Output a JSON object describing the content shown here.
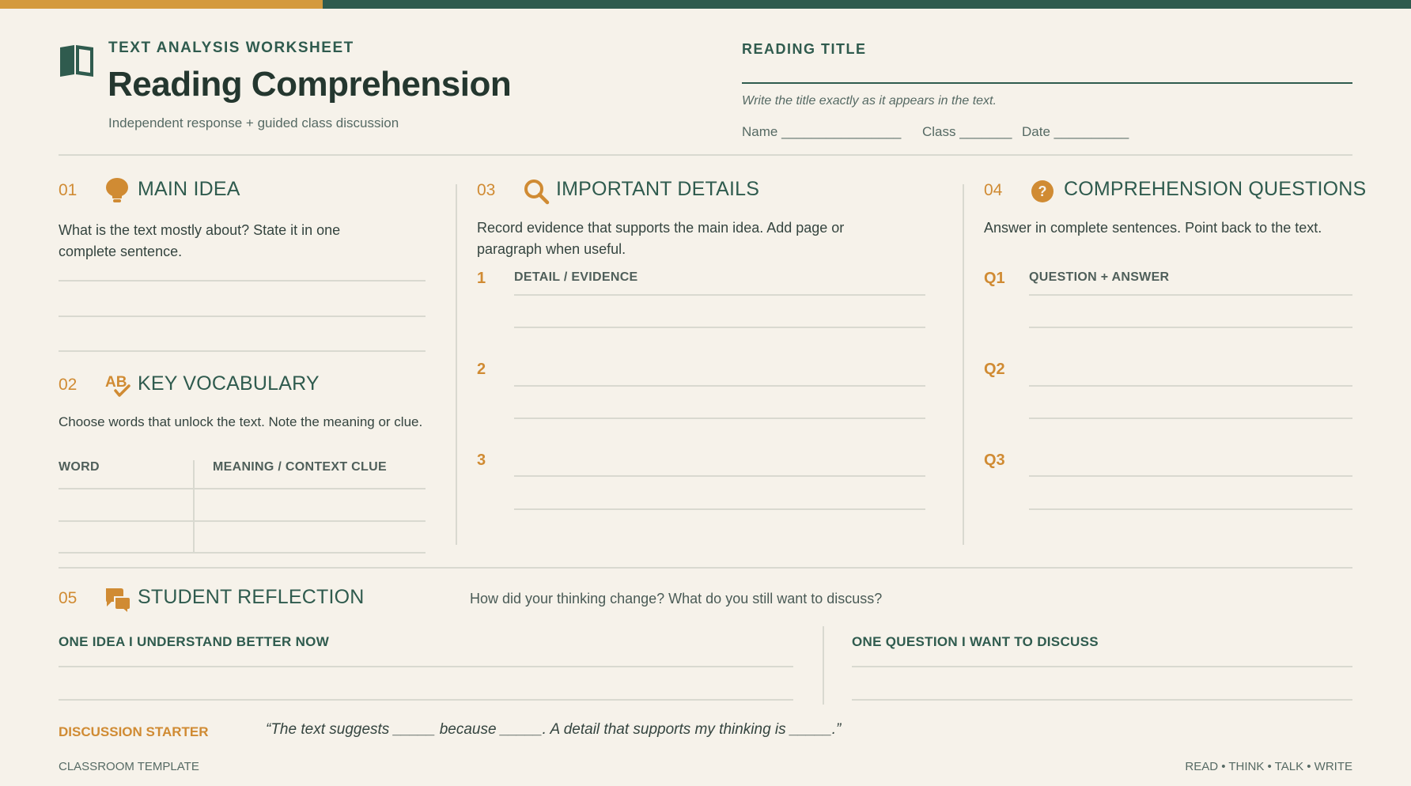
{
  "header": {
    "kicker": "TEXT ANALYSIS WORKSHEET",
    "title": "Reading Comprehension",
    "subtitle": "Independent response + guided class discussion",
    "reading_title_label": "READING TITLE",
    "reading_title_hint": "Write the title exactly as it appears in the text.",
    "name_label": "Name ________________",
    "class_label": "Class _______",
    "date_label": "Date __________"
  },
  "sections": {
    "main_idea": {
      "num": "01",
      "title": "MAIN IDEA",
      "desc": "What is the text mostly about? State it in one complete sentence."
    },
    "vocab": {
      "num": "02",
      "title": "KEY VOCABULARY",
      "desc": "Choose words that unlock the text. Note the meaning or clue.",
      "col_word": "WORD",
      "col_meaning": "MEANING / CONTEXT CLUE"
    },
    "details": {
      "num": "03",
      "title": "IMPORTANT DETAILS",
      "desc": "Record evidence that supports the main idea. Add page or paragraph when useful.",
      "col_header": "DETAIL / EVIDENCE",
      "rows": [
        "1",
        "2",
        "3"
      ]
    },
    "questions": {
      "num": "04",
      "title": "COMPREHENSION QUESTIONS",
      "desc": "Answer in complete sentences. Point back to the text.",
      "col_header": "QUESTION + ANSWER",
      "rows": [
        "Q1",
        "Q2",
        "Q3"
      ]
    },
    "reflection": {
      "num": "05",
      "title": "STUDENT REFLECTION",
      "prompt": "How did your thinking change? What do you still want to discuss?",
      "left_label": "ONE IDEA I UNDERSTAND BETTER NOW",
      "right_label": "ONE QUESTION I WANT TO DISCUSS",
      "starter_label": "DISCUSSION STARTER",
      "starter_text": "“The text suggests _____ because _____. A detail that supports my thinking is _____.”"
    }
  },
  "footer": {
    "left": "CLASSROOM TEMPLATE",
    "right": "READ • THINK • TALK • WRITE"
  },
  "icons": {
    "book": "book-icon",
    "lightbulb": "lightbulb-icon",
    "spellcheck": "spellcheck-icon",
    "search": "search-icon",
    "question": "question-icon",
    "chat": "chat-icon"
  },
  "colors": {
    "teal": "#2f5b4e",
    "orange": "#d08b33",
    "paper": "#f6f2ea"
  }
}
